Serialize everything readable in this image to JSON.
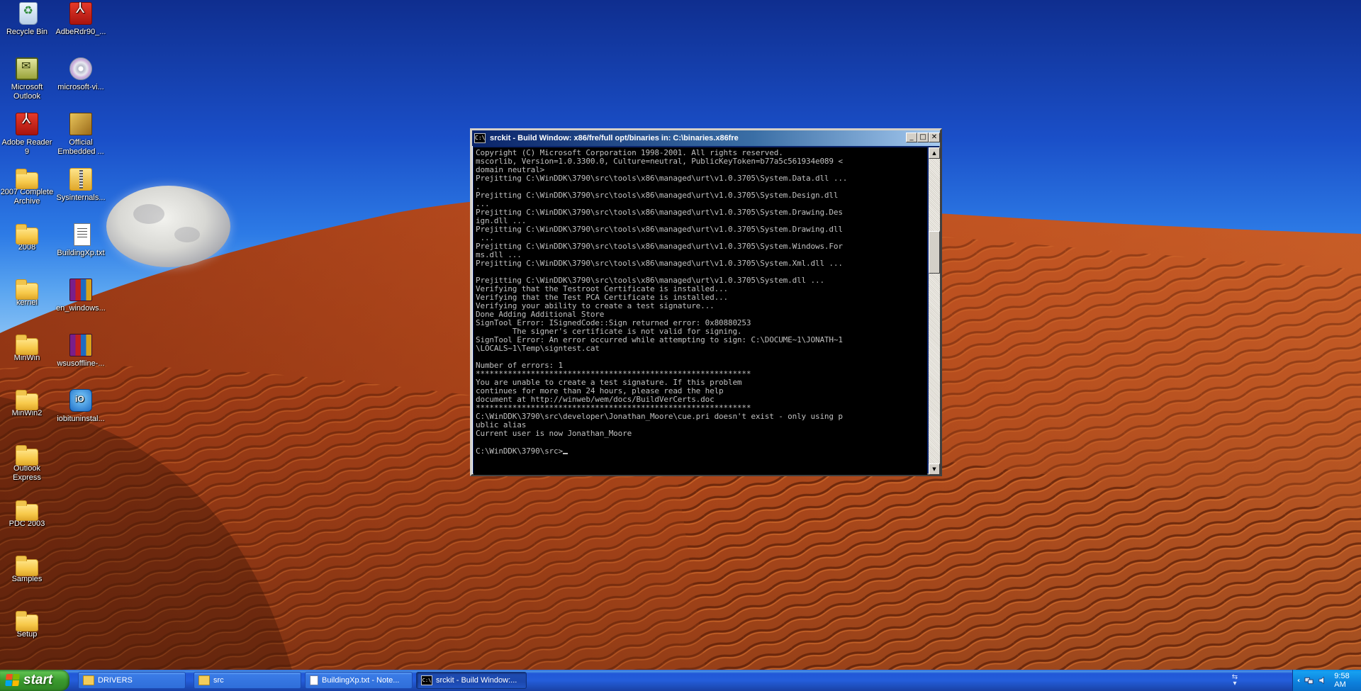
{
  "desktop": {
    "icons": [
      {
        "label": "Recycle Bin",
        "icon": "recycle-bin-icon"
      },
      {
        "label": "AdbeRdr90_...",
        "icon": "pdf-installer-icon"
      },
      {
        "label": "Microsoft Outlook",
        "icon": "outlook-icon"
      },
      {
        "label": "microsoft-vi...",
        "icon": "disc-image-icon"
      },
      {
        "label": "Adobe Reader 9",
        "icon": "adobe-reader-icon"
      },
      {
        "label": "Official Embedded ...",
        "icon": "package-icon"
      },
      {
        "label": "2007 Complete Archive",
        "icon": "folder-icon"
      },
      {
        "label": "Sysinternals...",
        "icon": "zip-folder-icon"
      },
      {
        "label": "2008",
        "icon": "folder-icon"
      },
      {
        "label": "BuildingXp.txt",
        "icon": "text-file-icon"
      },
      {
        "label": "kernel",
        "icon": "folder-icon"
      },
      {
        "label": "en_windows...",
        "icon": "winrar-icon"
      },
      {
        "label": "MinWin",
        "icon": "folder-icon"
      },
      {
        "label": "wsusoffline-...",
        "icon": "winrar-icon"
      },
      {
        "label": "MinWin2",
        "icon": "folder-icon"
      },
      {
        "label": "iobituninstal...",
        "icon": "iobit-icon"
      },
      {
        "label": "Outlook Express",
        "icon": "folder-icon"
      },
      {
        "label": "PDC 2003",
        "icon": "folder-icon"
      },
      {
        "label": "Samples",
        "icon": "folder-icon"
      },
      {
        "label": "Setup",
        "icon": "folder-icon"
      }
    ]
  },
  "console": {
    "title": "srckit - Build Window: x86/fre/full opt/binaries in: C:\\binaries.x86fre",
    "icon_text": "C:\\",
    "lines": "Copyright (C) Microsoft Corporation 1998-2001. All rights reserved.\nmscorlib, Version=1.0.3300.0, Culture=neutral, PublicKeyToken=b77a5c561934e089 <\ndomain neutral>\nPrejitting C:\\WinDDK\\3790\\src\\tools\\x86\\managed\\urt\\v1.0.3705\\System.Data.dll ...\n.\nPrejitting C:\\WinDDK\\3790\\src\\tools\\x86\\managed\\urt\\v1.0.3705\\System.Design.dll\n...\nPrejitting C:\\WinDDK\\3790\\src\\tools\\x86\\managed\\urt\\v1.0.3705\\System.Drawing.Des\nign.dll ...\nPrejitting C:\\WinDDK\\3790\\src\\tools\\x86\\managed\\urt\\v1.0.3705\\System.Drawing.dll\n ...\nPrejitting C:\\WinDDK\\3790\\src\\tools\\x86\\managed\\urt\\v1.0.3705\\System.Windows.For\nms.dll ...\nPrejitting C:\\WinDDK\\3790\\src\\tools\\x86\\managed\\urt\\v1.0.3705\\System.Xml.dll ...\n\nPrejitting C:\\WinDDK\\3790\\src\\tools\\x86\\managed\\urt\\v1.0.3705\\System.dll ...\nVerifying that the Testroot Certificate is installed...\nVerifying that the Test PCA Certificate is installed...\nVerifying your ability to create a test signature...\nDone Adding Additional Store\nSignTool Error: ISignedCode::Sign returned error: 0x80880253\n        The signer's certificate is not valid for signing.\nSignTool Error: An error occurred while attempting to sign: C:\\DOCUME~1\\JONATH~1\n\\LOCALS~1\\Temp\\signtest.cat\n\nNumber of errors: 1\n************************************************************\nYou are unable to create a test signature. If this problem\ncontinues for more than 24 hours, please read the help\ndocument at http://winweb/wem/docs/BuildVerCerts.doc\n************************************************************\nC:\\WinDDK\\3790\\src\\developer\\Jonathan_Moore\\cue.pri doesn't exist - only using p\nublic alias\nCurrent user is now Jonathan_Moore\n\nC:\\WinDDK\\3790\\src>",
    "buttons": {
      "minimize": "_",
      "maximize": "□",
      "close": "✕"
    }
  },
  "taskbar": {
    "start_label": "start",
    "tasks": [
      {
        "label": "DRIVERS",
        "icon": "folder-icon",
        "active": false
      },
      {
        "label": "src",
        "icon": "folder-icon",
        "active": false
      },
      {
        "label": "BuildingXp.txt - Note...",
        "icon": "notepad-icon",
        "active": false
      },
      {
        "label": "srckit - Build Window:...",
        "icon": "command-prompt-icon",
        "active": true
      }
    ],
    "clock": "9:58 AM"
  },
  "colors": {
    "taskbar_blue": "#245edb",
    "start_green": "#3a9a2e",
    "console_text": "#c0c0c0",
    "title_bar": "#0a246a"
  }
}
